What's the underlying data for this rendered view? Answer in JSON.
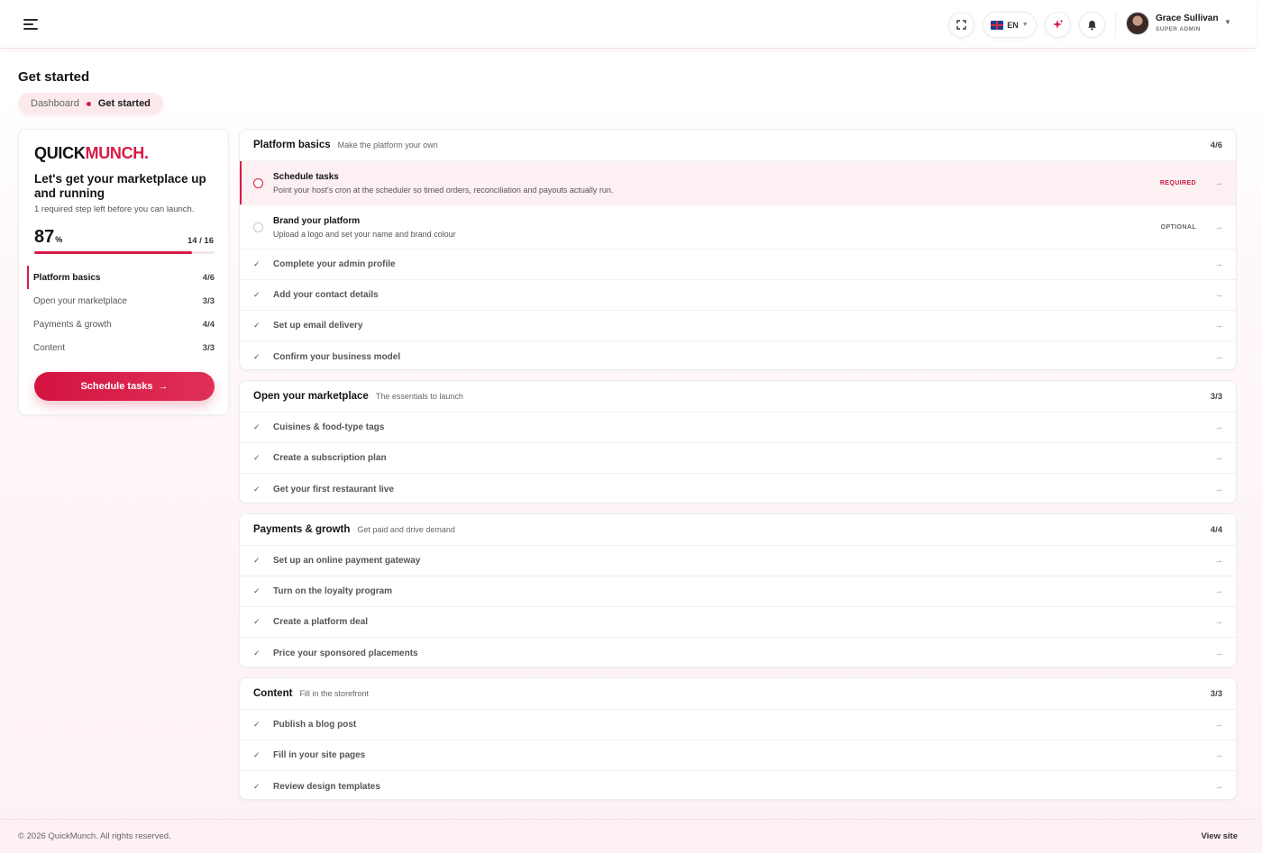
{
  "header": {
    "language": "EN",
    "user_name": "Grace Sullivan",
    "user_role": "SUPER ADMIN"
  },
  "page": {
    "title": "Get started",
    "breadcrumb": [
      "Dashboard",
      "Get started"
    ]
  },
  "sidebar": {
    "logo_part1": "QUICK",
    "logo_part2": "MUNCH.",
    "heading": "Let's get your marketplace up and running",
    "subtext": "1 required step left before you can launch.",
    "percent": "87",
    "percent_unit": "%",
    "progress_fraction": 0.875,
    "steps_count": "14 / 16",
    "sections": [
      {
        "label": "Platform basics",
        "count": "4/6"
      },
      {
        "label": "Open your marketplace",
        "count": "3/3"
      },
      {
        "label": "Payments & growth",
        "count": "4/4"
      },
      {
        "label": "Content",
        "count": "3/3"
      }
    ],
    "cta_label": "Schedule tasks"
  },
  "sections": {
    "platform": {
      "title": "Platform basics",
      "desc": "Make the platform your own",
      "count": "4/6",
      "tasks": [
        {
          "label": "Schedule tasks",
          "desc": "Point your host's cron at the scheduler so timed orders, reconciliation and payouts actually run.",
          "tag": "REQUIRED"
        },
        {
          "label": "Brand your platform",
          "desc": "Upload a logo and set your name and brand colour",
          "tag": "OPTIONAL"
        },
        {
          "label": "Complete your admin profile"
        },
        {
          "label": "Add your contact details"
        },
        {
          "label": "Set up email delivery"
        },
        {
          "label": "Confirm your business model"
        }
      ]
    },
    "marketplace": {
      "title": "Open your marketplace",
      "desc": "The essentials to launch",
      "count": "3/3",
      "tasks": [
        {
          "label": "Cuisines & food-type tags"
        },
        {
          "label": "Create a subscription plan"
        },
        {
          "label": "Get your first restaurant live"
        }
      ]
    },
    "payments": {
      "title": "Payments & growth",
      "desc": "Get paid and drive demand",
      "count": "4/4",
      "tasks": [
        {
          "label": "Set up an online payment gateway"
        },
        {
          "label": "Turn on the loyalty program"
        },
        {
          "label": "Create a platform deal"
        },
        {
          "label": "Price your sponsored placements"
        }
      ]
    },
    "content": {
      "title": "Content",
      "desc": "Fill in the storefront",
      "count": "3/3",
      "tasks": [
        {
          "label": "Publish a blog post"
        },
        {
          "label": "Fill in your site pages"
        },
        {
          "label": "Review design templates"
        }
      ]
    }
  },
  "footer": {
    "copyright": "© 2026 QuickMunch. All rights reserved.",
    "view_site": "View site"
  },
  "colors": {
    "accent": "#d81b45"
  }
}
